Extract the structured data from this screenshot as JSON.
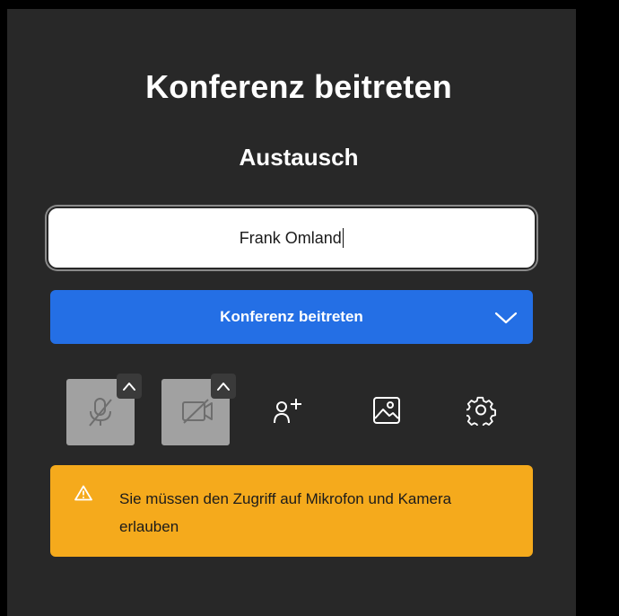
{
  "join_screen": {
    "title": "Konferenz beitreten",
    "room_name": "Austausch",
    "name_input": {
      "value": "Frank Omland"
    },
    "join_button": {
      "label": "Konferenz beitreten"
    }
  },
  "toolbar": {
    "items": [
      {
        "icon": "microphone-muted-icon",
        "state": "disabled"
      },
      {
        "icon": "camera-off-icon",
        "state": "disabled"
      },
      {
        "icon": "invite-people-icon"
      },
      {
        "icon": "virtual-background-icon"
      },
      {
        "icon": "settings-gear-icon"
      }
    ]
  },
  "warning": {
    "text": "Sie müssen den Zugriff auf Mikrofon und Kamera erlauben"
  },
  "colors": {
    "panel_bg": "#282828",
    "primary": "#246fe5",
    "warning": "#f5aa1c",
    "disabled_tile": "#a1a1a1"
  }
}
